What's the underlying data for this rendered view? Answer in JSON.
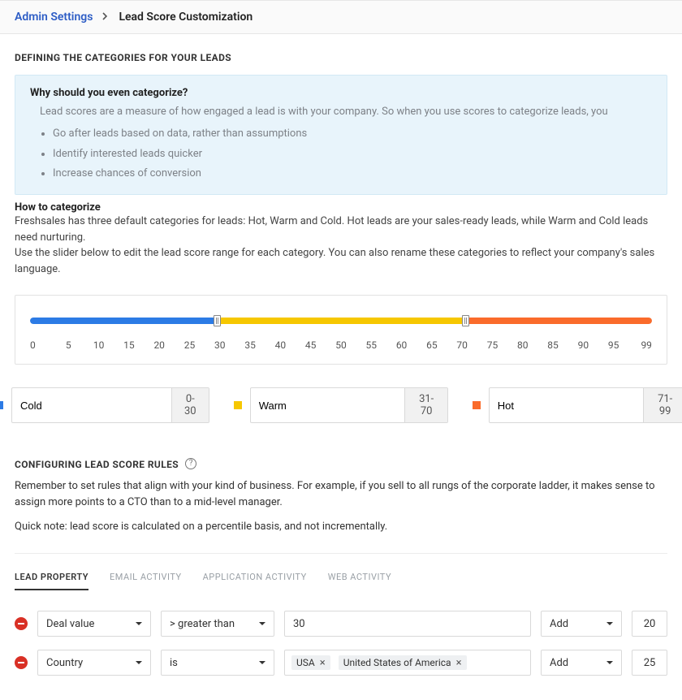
{
  "breadcrumb": {
    "root": "Admin Settings",
    "current": "Lead Score Customization"
  },
  "section1": {
    "title": "DEFINING THE CATEGORIES FOR YOUR LEADS",
    "info_heading": "Why should you even categorize?",
    "info_lead": "Lead scores are a measure of how engaged a lead is with your company. So when you use scores to categorize leads, you",
    "bullets": [
      "Go after leads based on data, rather than assumptions",
      "Identify interested leads quicker",
      "Increase chances of conversion"
    ],
    "howto_title": "How to categorize",
    "howto_line1": "Freshsales has three default categories for leads: Hot, Warm and Cold. Hot leads are your sales-ready leads, while Warm and Cold leads need nurturing.",
    "howto_line2": "Use the slider below to edit the lead score range for each category. You can also rename these categories to reflect your company's sales language."
  },
  "slider": {
    "ticks": [
      "0",
      "5",
      "10",
      "15",
      "20",
      "25",
      "30",
      "35",
      "40",
      "45",
      "50",
      "55",
      "60",
      "65",
      "70",
      "75",
      "80",
      "85",
      "90",
      "95",
      "99"
    ],
    "categories": [
      {
        "name": "Cold",
        "range": "0-30"
      },
      {
        "name": "Warm",
        "range": "31-70"
      },
      {
        "name": "Hot",
        "range": "71-99"
      }
    ]
  },
  "section2": {
    "title": "CONFIGURING LEAD SCORE RULES",
    "para1": "Remember to set rules that align with your kind of business. For example, if you sell to all rungs of the corporate ladder, it makes sense to assign more points to a CTO than to a mid-level manager.",
    "para2": "Quick note: lead score is calculated on a percentile basis, and not incrementally.",
    "tabs": [
      "LEAD PROPERTY",
      "EMAIL ACTIVITY",
      "APPLICATION ACTIVITY",
      "WEB ACTIVITY"
    ]
  },
  "rules": [
    {
      "property": "Deal value",
      "operator": "> greater than",
      "value_text": "30",
      "action": "Add",
      "score": "20"
    },
    {
      "property": "Country",
      "operator": "is",
      "chips": [
        "USA",
        "United States of America"
      ],
      "action": "Add",
      "score": "25"
    }
  ]
}
